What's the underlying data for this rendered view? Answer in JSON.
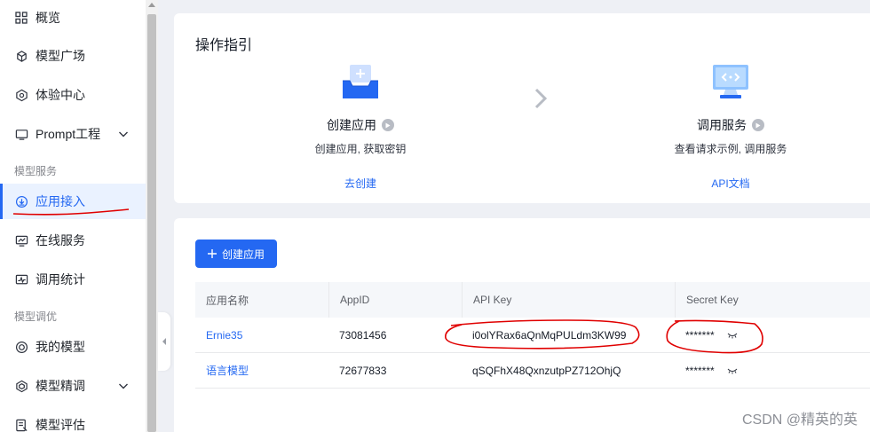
{
  "sidebar": {
    "items": [
      {
        "label": "概览",
        "icon": "grid-icon"
      },
      {
        "label": "模型广场",
        "icon": "cube-icon"
      },
      {
        "label": "体验中心",
        "icon": "hexagon-icon"
      },
      {
        "label": "Prompt工程",
        "icon": "monitor-icon"
      },
      {
        "label": "应用接入",
        "icon": "download-icon"
      },
      {
        "label": "在线服务",
        "icon": "chart-screen-icon"
      },
      {
        "label": "调用统计",
        "icon": "stats-icon"
      },
      {
        "label": "我的模型",
        "icon": "model-icon"
      },
      {
        "label": "模型精调",
        "icon": "tune-icon"
      },
      {
        "label": "模型评估",
        "icon": "evaluate-icon"
      }
    ],
    "groups": [
      "模型服务",
      "模型调优"
    ]
  },
  "guide": {
    "title": "操作指引",
    "steps": [
      {
        "title": "创建应用",
        "desc": "创建应用, 获取密钥",
        "link": "去创建"
      },
      {
        "title": "调用服务",
        "desc": "查看请求示例, 调用服务",
        "link": "API文档"
      }
    ]
  },
  "apps": {
    "create_button": "创建应用",
    "columns": [
      "应用名称",
      "AppID",
      "API Key",
      "Secret Key"
    ],
    "rows": [
      {
        "name": "Ernie35",
        "appid": "73081456",
        "api_key": "i0olYRax6aQnMqPULdm3KW99",
        "secret": "*******"
      },
      {
        "name": "语言模型",
        "appid": "72677833",
        "api_key": "qSQFhX48QxnzutpPZ712OhjQ",
        "secret": "*******"
      }
    ]
  },
  "watermark": "CSDN @精英的英",
  "colors": {
    "accent": "#2468f2",
    "annotation": "#e00000"
  }
}
